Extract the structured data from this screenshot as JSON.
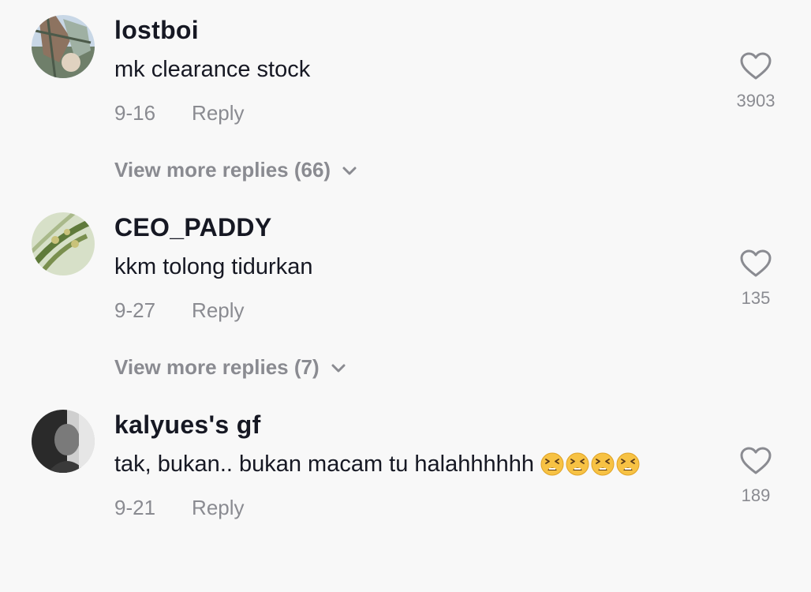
{
  "comments": [
    {
      "username": "lostboi",
      "text": "mk clearance stock",
      "date": "9-16",
      "reply_label": "Reply",
      "likes": "3903",
      "view_more": "View more replies (66)",
      "avatar_colors": [
        "#6f7f6a",
        "#c8d7e6",
        "#8d7360"
      ]
    },
    {
      "username": "CEO_PADDY",
      "text": "kkm tolong tidurkan",
      "date": "9-27",
      "reply_label": "Reply",
      "likes": "135",
      "view_more": "View more replies (7)",
      "avatar_colors": [
        "#5f7a3a",
        "#d7e0c8",
        "#a9b98a"
      ]
    },
    {
      "username": "kalyues's gf",
      "text": "tak, bukan.. bukan macam tu halahhhhhh",
      "emoji_count": 4,
      "emoji_icon": "tired-face-icon",
      "date": "9-21",
      "reply_label": "Reply",
      "likes": "189",
      "avatar_colors": [
        "#2a2a2a",
        "#7a7a7a",
        "#cfcfcf"
      ]
    }
  ],
  "icons": {
    "like": "heart-outline-icon",
    "expand": "chevron-down-icon"
  },
  "colors": {
    "background": "#f8f8f8",
    "primary_text": "#161823",
    "secondary_text": "#8a8b91"
  }
}
